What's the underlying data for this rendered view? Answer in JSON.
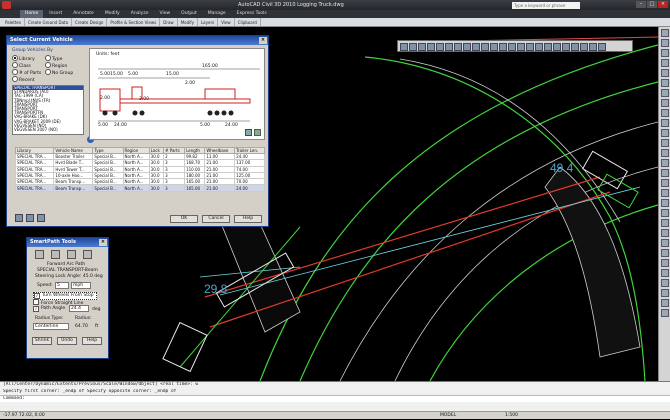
{
  "window": {
    "title": "AutoCAD Civil 3D 2010   Logging Truck.dwg",
    "search_placeholder": "Type a keyword or phrase"
  },
  "ribbon": {
    "tabs": [
      "Home",
      "Insert",
      "Annotate",
      "Modify",
      "Analyze",
      "View",
      "Output",
      "Manage",
      "Express Tools"
    ],
    "panels": [
      "Palettes",
      "Create Ground Data",
      "Create Design",
      "Profile & Section Views",
      "Draw",
      "Modify",
      "Layers",
      "View",
      "Clipboard"
    ]
  },
  "select_vehicle": {
    "title": "Select Current Vehicle",
    "group_label": "Group Vehicles By",
    "group_options": [
      "Library",
      "Type",
      "Class",
      "Region",
      "# of Parts",
      "No Group",
      "Recent"
    ],
    "units": "Units:  feet",
    "library_items": [
      "SPECIAL TRANSPORT",
      "STANDARDS (AU)",
      "TAC-1999 (CA)",
      "TBNmpl.tNVS (FR)",
      "TRANSPORT",
      "TRANSPORT",
      "TRANSPORTFN",
      "VAG-BRAKE (DK)",
      "VAG-BRAKET 2009 (DE)",
      "VEGVESEN (NO)",
      "VEGVESEN 2007 (NO)"
    ],
    "dim_labels": {
      "overall": "165.00",
      "d1": "5.00",
      "d2": "15.00",
      "d3": "5.00",
      "d4": "15.00",
      "d5": "2.00",
      "d6": "3.00",
      "d7": "2.00",
      "b1": "5.00",
      "b2": "24.00",
      "b3": "5.00",
      "b4": "24.00"
    },
    "table": {
      "headers": [
        "Library",
        "Vehicle Name",
        "Type",
        "Region",
        "Lock",
        "# Parts",
        "Length",
        "Wheelbase",
        "Trailer Len."
      ],
      "rows": [
        [
          "SPECIAL TRA...",
          "Booster Trailer",
          "Special B...",
          "North A...",
          "30.0",
          "2",
          "99.82",
          "11.00",
          "24.40"
        ],
        [
          "SPECIAL TRA...",
          "Hvrd Blade T...",
          "Special B...",
          "North A...",
          "30.0",
          "3",
          "168.70",
          "21.00",
          "137.00"
        ],
        [
          "SPECIAL TRA...",
          "Hvrd Tower T...",
          "Special B...",
          "North A...",
          "30.0",
          "3",
          "110.00",
          "21.00",
          "74.00"
        ],
        [
          "SPECIAL TRA...",
          "10-axle Hoo...",
          "Special B...",
          "North A...",
          "30.0",
          "3",
          "180.00",
          "21.00",
          "125.00"
        ],
        [
          "SPECIAL TRA...",
          "Beam Transp...",
          "Special B...",
          "North A...",
          "30.0",
          "3",
          "165.00",
          "21.00",
          "70.00"
        ],
        [
          "SPECIAL TRA...",
          "Beam Transp...",
          "Special B...",
          "North A...",
          "30.0",
          "3",
          "165.00",
          "21.00",
          "24.00"
        ]
      ]
    },
    "buttons": {
      "ok": "OK",
      "cancel": "Cancel",
      "help": "Help"
    }
  },
  "smartpath": {
    "title": "SmartPath Tools",
    "mode": "Forward Arc Path",
    "vehicle": "SPECIAL TRANSPORT-Beam",
    "steering": "Steering Lock Angle: 45.0 deg",
    "speed_label": "Speed:",
    "speed_value": "5",
    "speed_unit": "mph",
    "turn_wheels": "Turn Wheels From Stop",
    "force_straight": "Force Straight Line",
    "path_angle_label": "Path Angle",
    "path_angle_value": "24.4",
    "path_angle_unit": "deg",
    "radius_type_label": "Radius Type:",
    "radius_label": "Radius:",
    "radius_type_value": "Centerline",
    "radius_value": "64.70",
    "radius_unit": "ft",
    "buttons": {
      "shrink": "Shrink",
      "undo": "Undo",
      "help": "Help"
    }
  },
  "drawing": {
    "label_top": "49.4",
    "label_bottom": "29.8"
  },
  "command": {
    "lines": [
      "[All/Center/Dynamic/Extents/Previous/Scale/Window/Object] <real time>: w",
      "Specify first corner: _endp of Specify opposite corner: _endp of"
    ],
    "prompt": "Command:"
  },
  "status": {
    "coords": "-17.97  72.02,  0.00",
    "model": "MODEL",
    "scale": "1:500"
  },
  "colors": {
    "green": "#3fd43a",
    "red": "#e23a2a",
    "cyan": "#6fd6e8",
    "label": "#4ea6c8"
  }
}
